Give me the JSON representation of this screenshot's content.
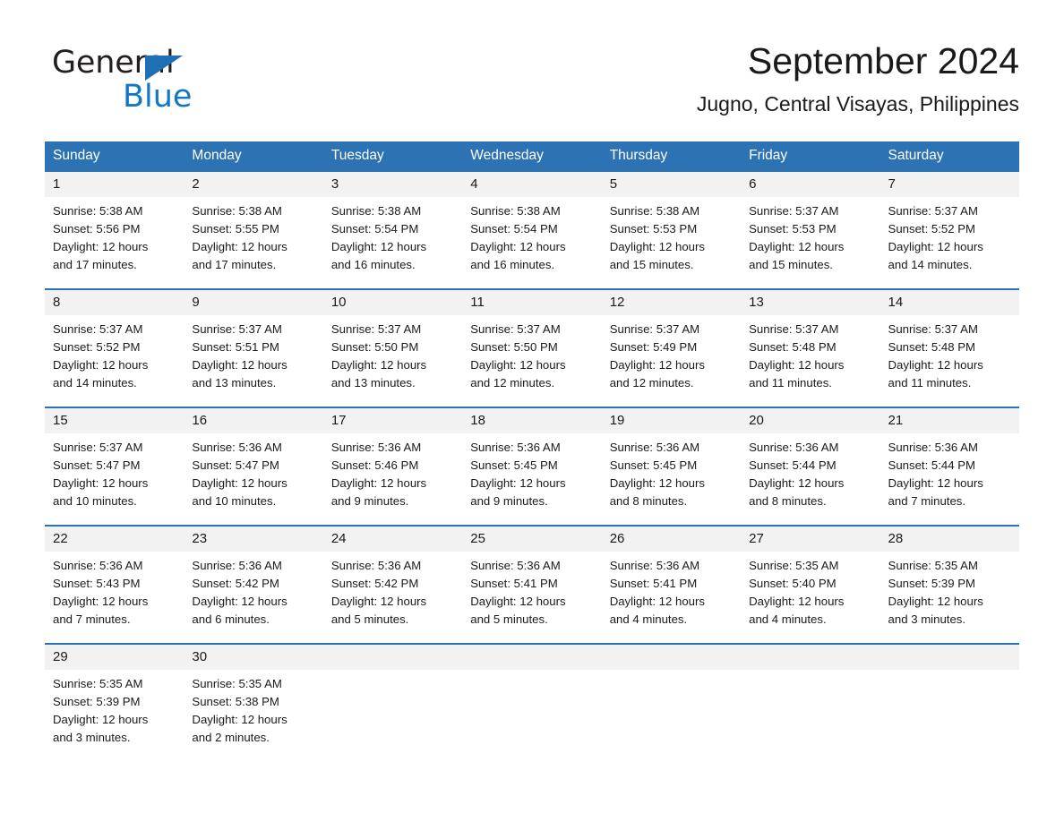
{
  "logo": {
    "word1": "General",
    "word2": "Blue",
    "triangle_color": "#1f6fb4",
    "blue_color": "#1277c4"
  },
  "header": {
    "title": "September 2024",
    "subtitle": "Jugno, Central Visayas, Philippines"
  },
  "theme": {
    "header_bg": "#2d72b3",
    "header_text": "#ffffff",
    "daynum_bg": "#f2f2f2",
    "row_border": "#2d72b3"
  },
  "weekday_headers": [
    "Sunday",
    "Monday",
    "Tuesday",
    "Wednesday",
    "Thursday",
    "Friday",
    "Saturday"
  ],
  "weeks": [
    [
      {
        "day": "1",
        "sunrise": "Sunrise: 5:38 AM",
        "sunset": "Sunset: 5:56 PM",
        "daylight1": "Daylight: 12 hours",
        "daylight2": "and 17 minutes."
      },
      {
        "day": "2",
        "sunrise": "Sunrise: 5:38 AM",
        "sunset": "Sunset: 5:55 PM",
        "daylight1": "Daylight: 12 hours",
        "daylight2": "and 17 minutes."
      },
      {
        "day": "3",
        "sunrise": "Sunrise: 5:38 AM",
        "sunset": "Sunset: 5:54 PM",
        "daylight1": "Daylight: 12 hours",
        "daylight2": "and 16 minutes."
      },
      {
        "day": "4",
        "sunrise": "Sunrise: 5:38 AM",
        "sunset": "Sunset: 5:54 PM",
        "daylight1": "Daylight: 12 hours",
        "daylight2": "and 16 minutes."
      },
      {
        "day": "5",
        "sunrise": "Sunrise: 5:38 AM",
        "sunset": "Sunset: 5:53 PM",
        "daylight1": "Daylight: 12 hours",
        "daylight2": "and 15 minutes."
      },
      {
        "day": "6",
        "sunrise": "Sunrise: 5:37 AM",
        "sunset": "Sunset: 5:53 PM",
        "daylight1": "Daylight: 12 hours",
        "daylight2": "and 15 minutes."
      },
      {
        "day": "7",
        "sunrise": "Sunrise: 5:37 AM",
        "sunset": "Sunset: 5:52 PM",
        "daylight1": "Daylight: 12 hours",
        "daylight2": "and 14 minutes."
      }
    ],
    [
      {
        "day": "8",
        "sunrise": "Sunrise: 5:37 AM",
        "sunset": "Sunset: 5:52 PM",
        "daylight1": "Daylight: 12 hours",
        "daylight2": "and 14 minutes."
      },
      {
        "day": "9",
        "sunrise": "Sunrise: 5:37 AM",
        "sunset": "Sunset: 5:51 PM",
        "daylight1": "Daylight: 12 hours",
        "daylight2": "and 13 minutes."
      },
      {
        "day": "10",
        "sunrise": "Sunrise: 5:37 AM",
        "sunset": "Sunset: 5:50 PM",
        "daylight1": "Daylight: 12 hours",
        "daylight2": "and 13 minutes."
      },
      {
        "day": "11",
        "sunrise": "Sunrise: 5:37 AM",
        "sunset": "Sunset: 5:50 PM",
        "daylight1": "Daylight: 12 hours",
        "daylight2": "and 12 minutes."
      },
      {
        "day": "12",
        "sunrise": "Sunrise: 5:37 AM",
        "sunset": "Sunset: 5:49 PM",
        "daylight1": "Daylight: 12 hours",
        "daylight2": "and 12 minutes."
      },
      {
        "day": "13",
        "sunrise": "Sunrise: 5:37 AM",
        "sunset": "Sunset: 5:48 PM",
        "daylight1": "Daylight: 12 hours",
        "daylight2": "and 11 minutes."
      },
      {
        "day": "14",
        "sunrise": "Sunrise: 5:37 AM",
        "sunset": "Sunset: 5:48 PM",
        "daylight1": "Daylight: 12 hours",
        "daylight2": "and 11 minutes."
      }
    ],
    [
      {
        "day": "15",
        "sunrise": "Sunrise: 5:37 AM",
        "sunset": "Sunset: 5:47 PM",
        "daylight1": "Daylight: 12 hours",
        "daylight2": "and 10 minutes."
      },
      {
        "day": "16",
        "sunrise": "Sunrise: 5:36 AM",
        "sunset": "Sunset: 5:47 PM",
        "daylight1": "Daylight: 12 hours",
        "daylight2": "and 10 minutes."
      },
      {
        "day": "17",
        "sunrise": "Sunrise: 5:36 AM",
        "sunset": "Sunset: 5:46 PM",
        "daylight1": "Daylight: 12 hours",
        "daylight2": "and 9 minutes."
      },
      {
        "day": "18",
        "sunrise": "Sunrise: 5:36 AM",
        "sunset": "Sunset: 5:45 PM",
        "daylight1": "Daylight: 12 hours",
        "daylight2": "and 9 minutes."
      },
      {
        "day": "19",
        "sunrise": "Sunrise: 5:36 AM",
        "sunset": "Sunset: 5:45 PM",
        "daylight1": "Daylight: 12 hours",
        "daylight2": "and 8 minutes."
      },
      {
        "day": "20",
        "sunrise": "Sunrise: 5:36 AM",
        "sunset": "Sunset: 5:44 PM",
        "daylight1": "Daylight: 12 hours",
        "daylight2": "and 8 minutes."
      },
      {
        "day": "21",
        "sunrise": "Sunrise: 5:36 AM",
        "sunset": "Sunset: 5:44 PM",
        "daylight1": "Daylight: 12 hours",
        "daylight2": "and 7 minutes."
      }
    ],
    [
      {
        "day": "22",
        "sunrise": "Sunrise: 5:36 AM",
        "sunset": "Sunset: 5:43 PM",
        "daylight1": "Daylight: 12 hours",
        "daylight2": "and 7 minutes."
      },
      {
        "day": "23",
        "sunrise": "Sunrise: 5:36 AM",
        "sunset": "Sunset: 5:42 PM",
        "daylight1": "Daylight: 12 hours",
        "daylight2": "and 6 minutes."
      },
      {
        "day": "24",
        "sunrise": "Sunrise: 5:36 AM",
        "sunset": "Sunset: 5:42 PM",
        "daylight1": "Daylight: 12 hours",
        "daylight2": "and 5 minutes."
      },
      {
        "day": "25",
        "sunrise": "Sunrise: 5:36 AM",
        "sunset": "Sunset: 5:41 PM",
        "daylight1": "Daylight: 12 hours",
        "daylight2": "and 5 minutes."
      },
      {
        "day": "26",
        "sunrise": "Sunrise: 5:36 AM",
        "sunset": "Sunset: 5:41 PM",
        "daylight1": "Daylight: 12 hours",
        "daylight2": "and 4 minutes."
      },
      {
        "day": "27",
        "sunrise": "Sunrise: 5:35 AM",
        "sunset": "Sunset: 5:40 PM",
        "daylight1": "Daylight: 12 hours",
        "daylight2": "and 4 minutes."
      },
      {
        "day": "28",
        "sunrise": "Sunrise: 5:35 AM",
        "sunset": "Sunset: 5:39 PM",
        "daylight1": "Daylight: 12 hours",
        "daylight2": "and 3 minutes."
      }
    ],
    [
      {
        "day": "29",
        "sunrise": "Sunrise: 5:35 AM",
        "sunset": "Sunset: 5:39 PM",
        "daylight1": "Daylight: 12 hours",
        "daylight2": "and 3 minutes."
      },
      {
        "day": "30",
        "sunrise": "Sunrise: 5:35 AM",
        "sunset": "Sunset: 5:38 PM",
        "daylight1": "Daylight: 12 hours",
        "daylight2": "and 2 minutes."
      },
      {
        "day": "",
        "sunrise": "",
        "sunset": "",
        "daylight1": "",
        "daylight2": ""
      },
      {
        "day": "",
        "sunrise": "",
        "sunset": "",
        "daylight1": "",
        "daylight2": ""
      },
      {
        "day": "",
        "sunrise": "",
        "sunset": "",
        "daylight1": "",
        "daylight2": ""
      },
      {
        "day": "",
        "sunrise": "",
        "sunset": "",
        "daylight1": "",
        "daylight2": ""
      },
      {
        "day": "",
        "sunrise": "",
        "sunset": "",
        "daylight1": "",
        "daylight2": ""
      }
    ]
  ]
}
